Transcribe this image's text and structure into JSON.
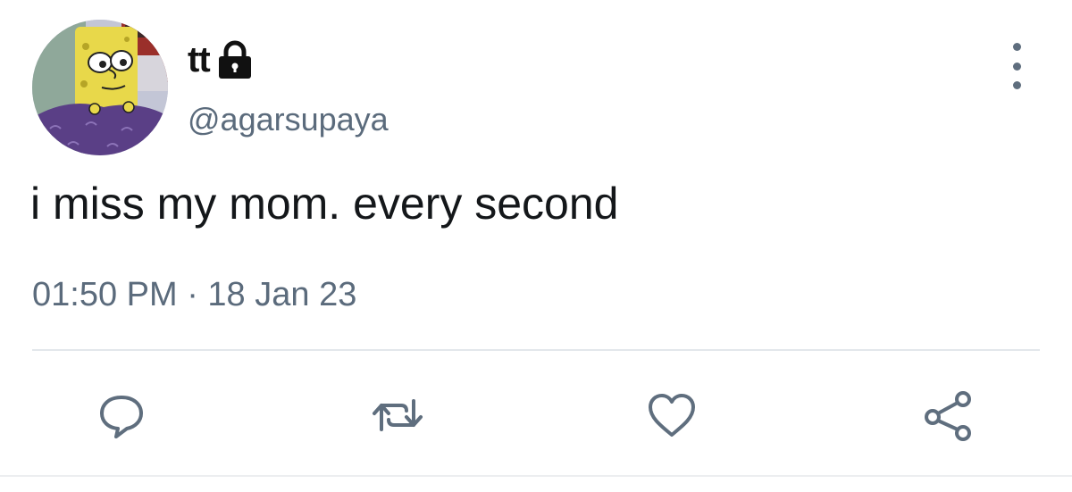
{
  "author": {
    "display_name": "tt",
    "handle": "@agarsupaya",
    "protected_icon": "lock-icon",
    "avatar_icon": "cartoon-avatar"
  },
  "tweet": {
    "text": "i miss my mom. every second",
    "timestamp": "01:50 PM · 18 Jan 23"
  },
  "actions": [
    {
      "name": "reply",
      "icon": "reply-icon"
    },
    {
      "name": "retweet",
      "icon": "retweet-icon"
    },
    {
      "name": "like",
      "icon": "heart-icon"
    },
    {
      "name": "share",
      "icon": "share-icon"
    }
  ],
  "menu": {
    "icon": "more-vertical-icon"
  },
  "colors": {
    "text": "#14171a",
    "secondary": "#5b6b7c",
    "icon": "#5f6e7e",
    "divider": "#e3e7eb"
  }
}
